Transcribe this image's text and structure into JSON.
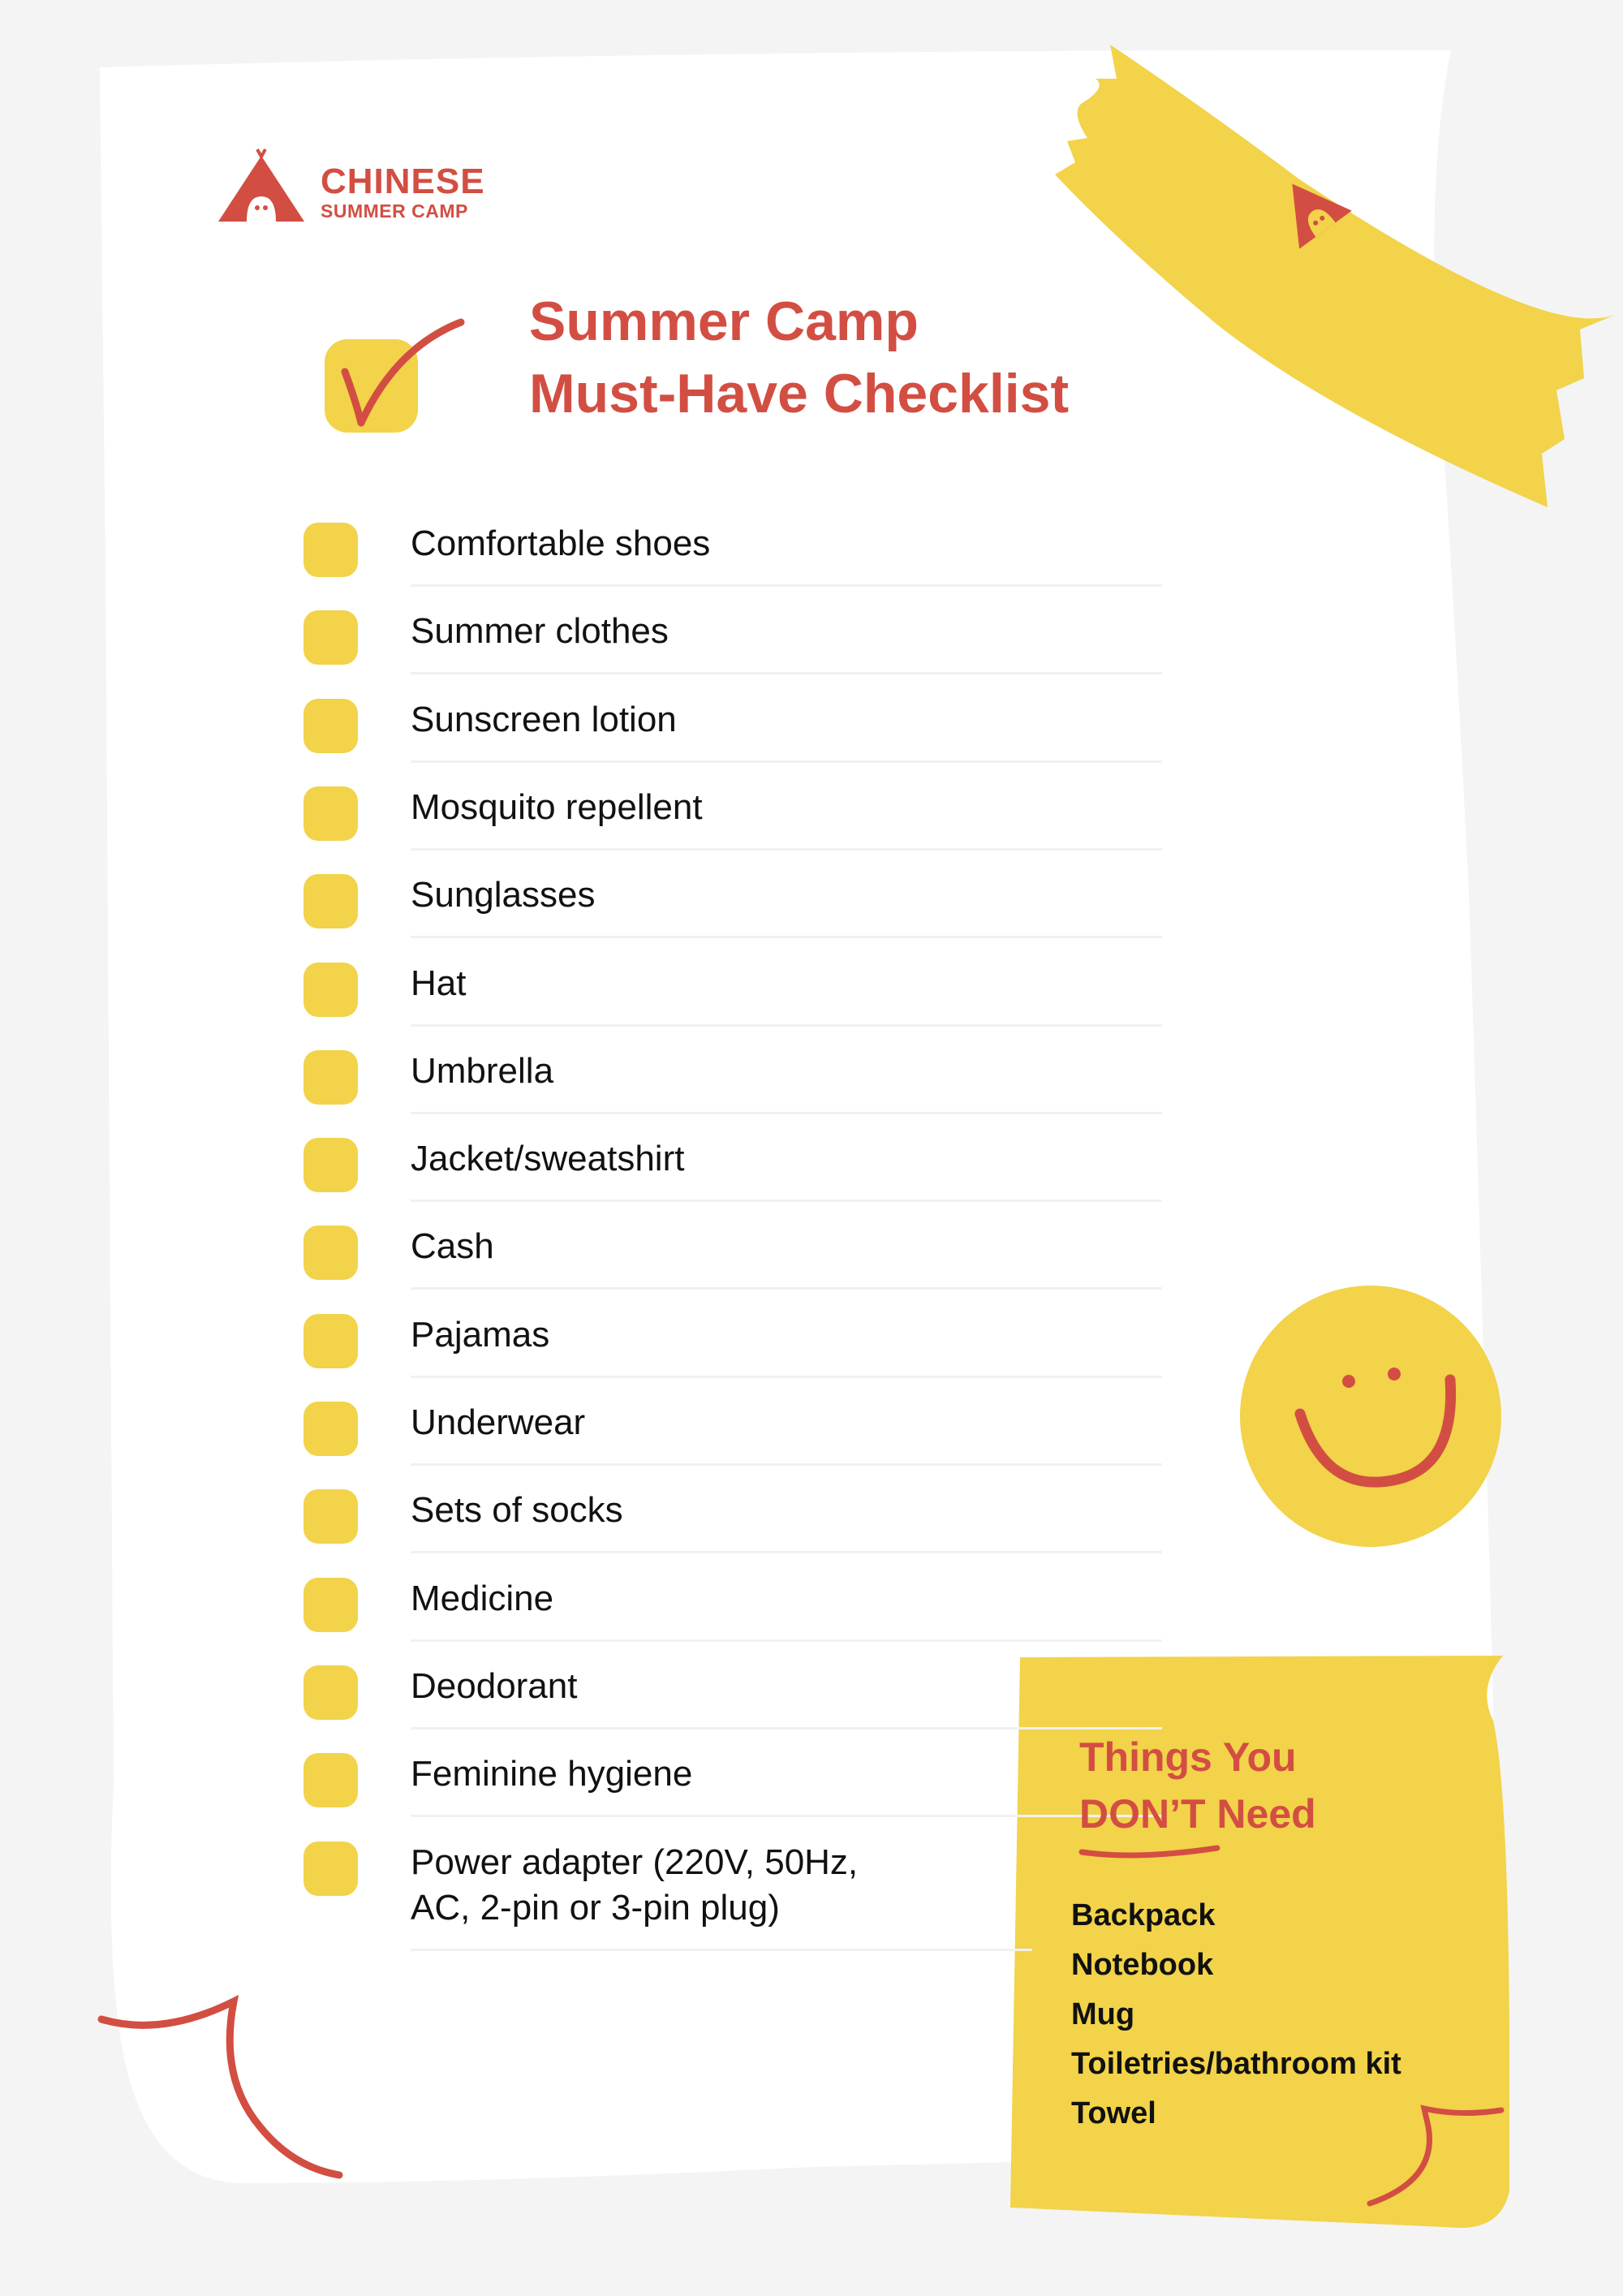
{
  "brand": {
    "line1": "CHINESE",
    "line2": "SUMMER CAMP",
    "logo_icon": "tent-icon",
    "color": "#d34e42"
  },
  "title": {
    "line1": "Summer Camp",
    "line2": "Must-Have Checklist"
  },
  "checklist": {
    "items": [
      {
        "label": "Comfortable shoes",
        "checked": false
      },
      {
        "label": "Summer clothes",
        "checked": false
      },
      {
        "label": "Sunscreen lotion",
        "checked": false
      },
      {
        "label": "Mosquito repellent",
        "checked": false
      },
      {
        "label": "Sunglasses",
        "checked": false
      },
      {
        "label": "Hat",
        "checked": false
      },
      {
        "label": "Umbrella",
        "checked": false
      },
      {
        "label": "Jacket/sweatshirt",
        "checked": false
      },
      {
        "label": "Cash",
        "checked": false
      },
      {
        "label": "Pajamas",
        "checked": false
      },
      {
        "label": "Underwear",
        "checked": false
      },
      {
        "label": "Sets of socks",
        "checked": false
      },
      {
        "label": "Medicine",
        "checked": false
      },
      {
        "label": "Deodorant",
        "checked": false
      },
      {
        "label": "Feminine hygiene",
        "checked": false
      },
      {
        "label": "Power adapter (220V, 50Hz,",
        "label_line2": "AC, 2-pin or 3-pin plug)",
        "checked": false
      }
    ]
  },
  "dont_need": {
    "title_line1": "Things You",
    "title_line2": "DON’T Need",
    "items": [
      "Backpack",
      "Notebook",
      "Mug",
      "Toiletries/bathroom kit",
      "Towel"
    ]
  },
  "colors": {
    "accent_red": "#d34e42",
    "accent_yellow": "#f2d34a",
    "paper": "#ffffff",
    "background": "#f4f4f4"
  }
}
